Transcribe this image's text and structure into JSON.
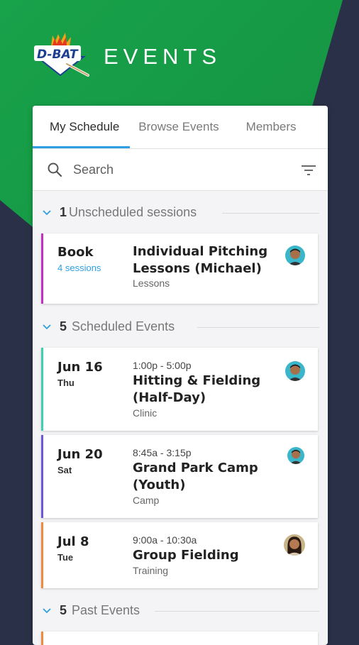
{
  "app": {
    "logo_text": "D-BAT",
    "title": "EVENTS"
  },
  "tabs": [
    {
      "label": "My Schedule",
      "active": true
    },
    {
      "label": "Browse Events",
      "active": false
    },
    {
      "label": "Members",
      "active": false
    }
  ],
  "search": {
    "placeholder": "Search"
  },
  "sections": {
    "unscheduled": {
      "count": "1",
      "label": "Unscheduled sessions"
    },
    "scheduled": {
      "count": "5",
      "label": "Scheduled Events"
    },
    "past": {
      "count": "5",
      "label": "Past Events"
    }
  },
  "unscheduled_items": [
    {
      "action": "Book",
      "sessions": "4 sessions",
      "title_line1": "Individual Pitching",
      "title_line2": "Lessons (Michael)",
      "category": "Lessons",
      "color": "#c630c0"
    }
  ],
  "scheduled_items": [
    {
      "date": "Jun 16",
      "day": "Thu",
      "time": "1:00p - 5:00p",
      "title_line1": "Hitting & Fielding",
      "title_line2": "(Half-Day)",
      "category": "Clinic",
      "color": "#3ed0b0"
    },
    {
      "date": "Jun 20",
      "day": "Sat",
      "time": "8:45a - 3:15p",
      "title_line1": "Grand Park Camp",
      "title_line2": "(Youth)",
      "category": "Camp",
      "color": "#6a5ad8"
    },
    {
      "date": "Jul 8",
      "day": "Tue",
      "time": "9:00a - 10:30a",
      "title_line1": "Group Fielding",
      "category": "Training",
      "color": "#f08a3c"
    }
  ],
  "colors": {
    "accent": "#2f9ee4",
    "green": "#18a24a",
    "navy": "#2a3047"
  }
}
